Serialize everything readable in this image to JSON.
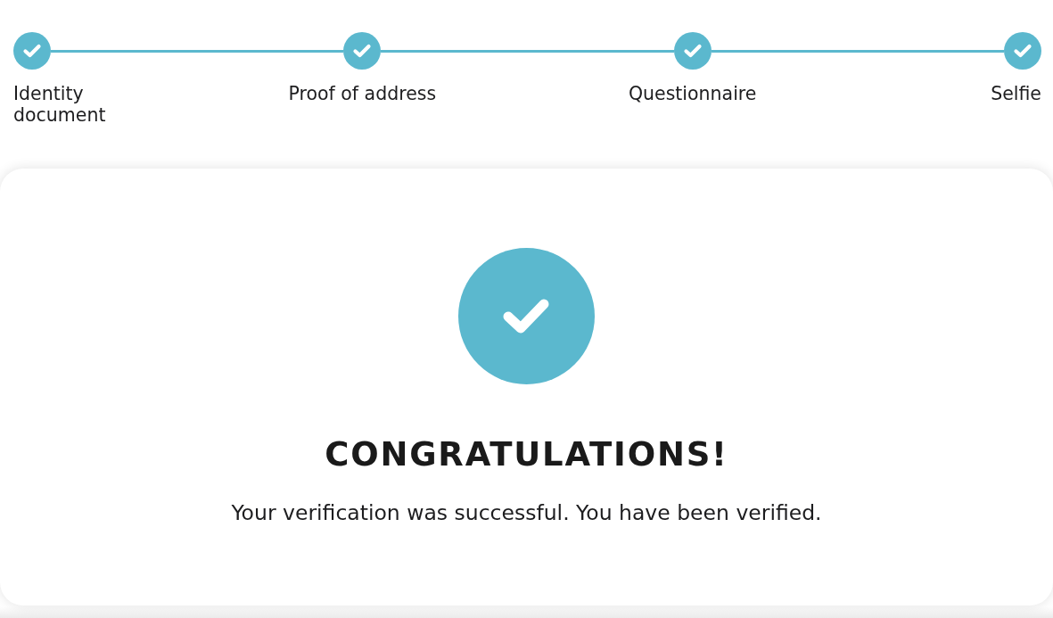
{
  "steps": [
    {
      "label": "Identity document",
      "completed": true
    },
    {
      "label": "Proof of address",
      "completed": true
    },
    {
      "label": "Questionnaire",
      "completed": true
    },
    {
      "label": "Selfie",
      "completed": true
    }
  ],
  "result": {
    "kind": "success",
    "title": "CONGRATULATIONS!",
    "message": "Your verification was successful. You have been verified."
  }
}
